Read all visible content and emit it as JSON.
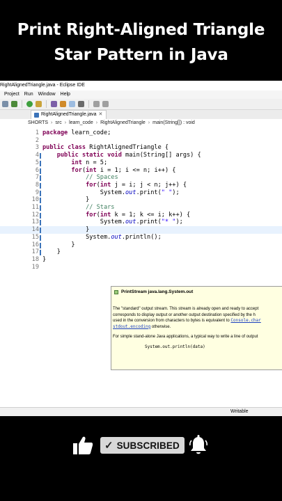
{
  "overlay": {
    "title_line1": "Print Right-Aligned Triangle",
    "title_line2": "Star Pattern in Java"
  },
  "window": {
    "title": "RightAlignedTriangle.java - Eclipse IDE"
  },
  "menu": [
    "Project",
    "Run",
    "Window",
    "Help"
  ],
  "editor_tab": {
    "label": "RightAlignedTriangle.java",
    "close": "✕"
  },
  "breadcrumb": [
    "SHORTS",
    "src",
    "learn_code",
    "RightAlignedTriangle",
    "main(String[]) : void"
  ],
  "code_lines": [
    {
      "n": "1",
      "text": "package learn_code;"
    },
    {
      "n": "2",
      "text": ""
    },
    {
      "n": "3",
      "text": "public class RightAlignedTriangle {"
    },
    {
      "n": "4",
      "text": "    public static void main(String[] args) {"
    },
    {
      "n": "5",
      "text": "        int n = 5;"
    },
    {
      "n": "6",
      "text": "        for(int i = 1; i <= n; i++) {"
    },
    {
      "n": "7",
      "text": "            // Spaces"
    },
    {
      "n": "8",
      "text": "            for(int j = i; j < n; j++) {"
    },
    {
      "n": "9",
      "text": "                System.out.print(\" \");"
    },
    {
      "n": "10",
      "text": "            }"
    },
    {
      "n": "11",
      "text": "            // Stars"
    },
    {
      "n": "12",
      "text": "            for(int k = 1; k <= i; k++) {"
    },
    {
      "n": "13",
      "text": "                System.out.print(\"* \");"
    },
    {
      "n": "14",
      "text": "            }"
    },
    {
      "n": "15",
      "text": "            System.out.println();"
    },
    {
      "n": "16",
      "text": "        }"
    },
    {
      "n": "17",
      "text": "    }"
    },
    {
      "n": "18",
      "text": "}"
    },
    {
      "n": "19",
      "text": ""
    }
  ],
  "tooltip": {
    "header": "PrintStream java.lang.System.out",
    "line1": "The \"standard\" output stream. This stream is already open and ready to accept",
    "line2": "corresponds to display output or another output destination specified by the h",
    "line3_prefix": "used in the conversion from characters to bytes is equivalent to ",
    "line3_link": "Console.char",
    "line4_link": "stdout.encoding",
    "line4_suffix": " otherwise.",
    "line5": "For simple stand-alone Java applications, a typical way to write a line of output",
    "example": "System.out.println(data)"
  },
  "status": {
    "writable": "Writable"
  },
  "subscribe": {
    "label": "SUBSCRIBED",
    "check": "✓"
  },
  "colors": {
    "keyword": "#7f0055",
    "comment": "#3f7f5f",
    "string": "#2a00ff",
    "field": "#0000c0",
    "tooltip_bg": "#ffffe1"
  }
}
